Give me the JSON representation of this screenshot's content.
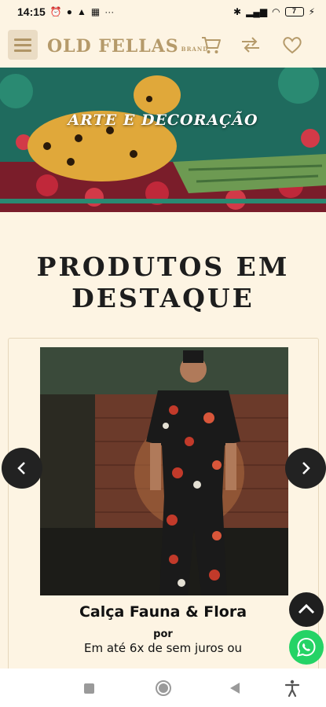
{
  "status_bar": {
    "time": "14:15",
    "more": "···",
    "battery": "7"
  },
  "header": {
    "logo_text": "OLD FELLAS",
    "logo_suffix": "BRAND"
  },
  "banner": {
    "title": "ARTE E DECORAÇÃO"
  },
  "section": {
    "title_line1": "PRODUTOS EM",
    "title_line2": "DESTAQUE"
  },
  "product": {
    "name": "Calça Fauna & Flora",
    "price_prefix": "por",
    "installments": "Em até 6x de sem juros ou"
  },
  "icons": {
    "menu": "hamburger-menu-icon",
    "cart": "cart-icon",
    "compare": "compare-icon",
    "wishlist": "heart-icon",
    "prev": "chevron-left-icon",
    "next": "chevron-right-icon",
    "scroll_top": "chevron-up-icon",
    "whatsapp": "whatsapp-icon"
  },
  "colors": {
    "background": "#fdf4e3",
    "brand_gold": "#b59a6a",
    "whatsapp_green": "#25d366",
    "dark_button": "#222222"
  }
}
